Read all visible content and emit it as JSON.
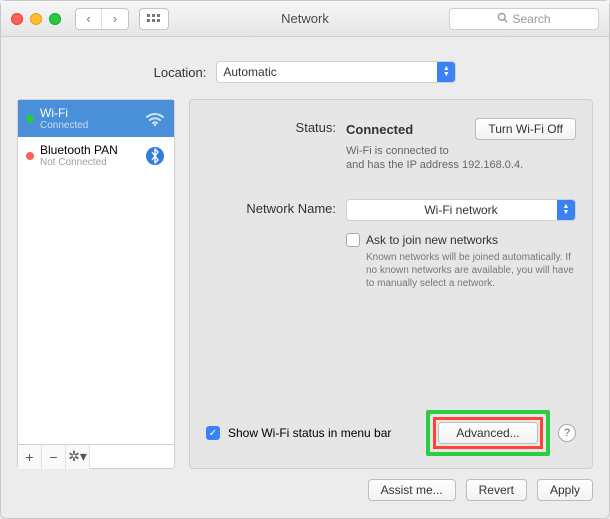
{
  "window": {
    "title": "Network",
    "search_placeholder": "Search"
  },
  "location": {
    "label": "Location:",
    "value": "Automatic"
  },
  "sidebar": {
    "items": [
      {
        "name": "Wi-Fi",
        "status": "Connected",
        "dot": "green",
        "selected": true
      },
      {
        "name": "Bluetooth PAN",
        "status": "Not Connected",
        "dot": "red",
        "selected": false
      }
    ]
  },
  "detail": {
    "status_label": "Status:",
    "status_value": "Connected",
    "wifi_toggle": "Turn Wi-Fi Off",
    "status_sub": "Wi-Fi is connected to\n and has the IP address 192.168.0.4.",
    "network_name_label": "Network Name:",
    "network_name_value": "Wi-Fi network",
    "ask_join": "Ask to join new networks",
    "ask_note": "Known networks will be joined automatically. If no known networks are available, you will have to manually select a network.",
    "show_status": "Show Wi-Fi status in menu bar",
    "advanced": "Advanced...",
    "help": "?"
  },
  "buttons": {
    "assist": "Assist me...",
    "revert": "Revert",
    "apply": "Apply"
  }
}
